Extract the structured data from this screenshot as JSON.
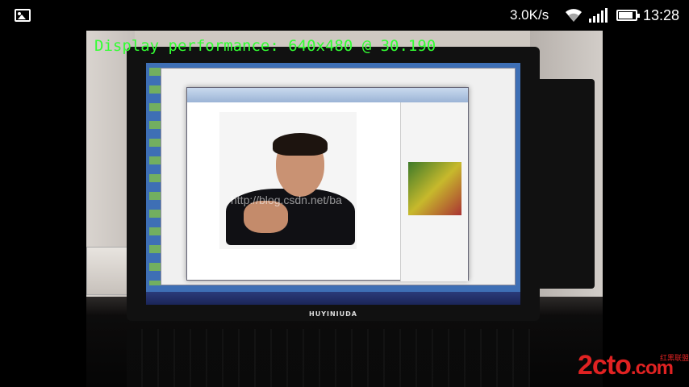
{
  "status_bar": {
    "network_speed": "3.0K/s",
    "time": "13:28",
    "icons": [
      "gallery-icon",
      "wifi-icon",
      "signal-icon",
      "battery-icon"
    ]
  },
  "camera_preview": {
    "overlay_text": "Display performance: 640x480 @ 30.190",
    "overlay_color": "#33ff33",
    "watermark": "http://blog.csdn.net/ba",
    "monitor_brand": "HUYINIUDA"
  },
  "site_logo": {
    "main": "2cto",
    "domain": ".com",
    "sub": "红黑联盟"
  }
}
